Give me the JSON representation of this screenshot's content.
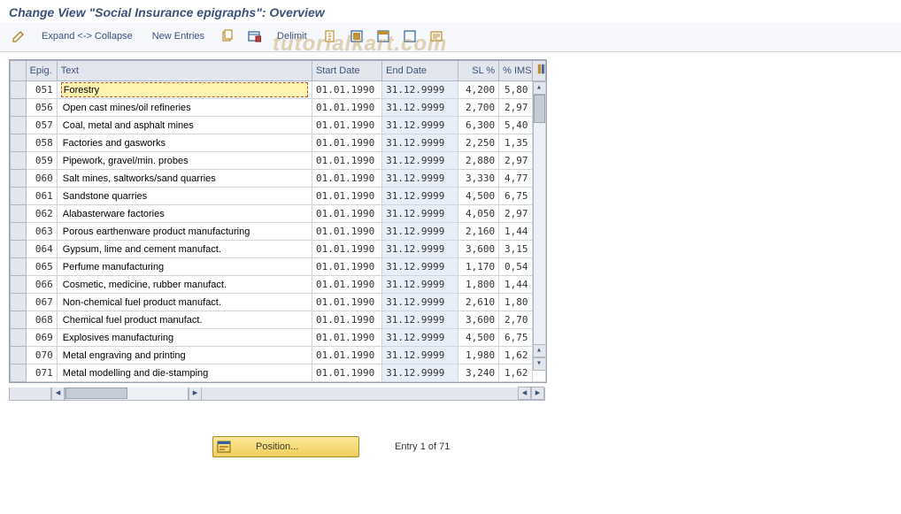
{
  "title": "Change View \"Social Insurance epigraphs\": Overview",
  "watermark": "tutorialkart.com",
  "toolbar": {
    "expand_collapse": "Expand <-> Collapse",
    "new_entries": "New Entries",
    "delimit": "Delimit"
  },
  "columns": {
    "epig": "Epig.",
    "text": "Text",
    "start": "Start Date",
    "end": "End Date",
    "sl": "SL %",
    "ims": "% IMS"
  },
  "rows": [
    {
      "epig": "051",
      "text": "Forestry",
      "start": "01.01.1990",
      "end": "31.12.9999",
      "sl": "4,200",
      "ims": "5,80"
    },
    {
      "epig": "056",
      "text": "Open cast mines/oil refineries",
      "start": "01.01.1990",
      "end": "31.12.9999",
      "sl": "2,700",
      "ims": "2,97"
    },
    {
      "epig": "057",
      "text": "Coal, metal and asphalt mines",
      "start": "01.01.1990",
      "end": "31.12.9999",
      "sl": "6,300",
      "ims": "5,40"
    },
    {
      "epig": "058",
      "text": "Factories and gasworks",
      "start": "01.01.1990",
      "end": "31.12.9999",
      "sl": "2,250",
      "ims": "1,35"
    },
    {
      "epig": "059",
      "text": "Pipework, gravel/min. probes",
      "start": "01.01.1990",
      "end": "31.12.9999",
      "sl": "2,880",
      "ims": "2,97"
    },
    {
      "epig": "060",
      "text": "Salt mines, saltworks/sand quarries",
      "start": "01.01.1990",
      "end": "31.12.9999",
      "sl": "3,330",
      "ims": "4,77"
    },
    {
      "epig": "061",
      "text": "Sandstone quarries",
      "start": "01.01.1990",
      "end": "31.12.9999",
      "sl": "4,500",
      "ims": "6,75"
    },
    {
      "epig": "062",
      "text": "Alabasterware factories",
      "start": "01.01.1990",
      "end": "31.12.9999",
      "sl": "4,050",
      "ims": "2,97"
    },
    {
      "epig": "063",
      "text": "Porous earthenware product manufacturing",
      "start": "01.01.1990",
      "end": "31.12.9999",
      "sl": "2,160",
      "ims": "1,44"
    },
    {
      "epig": "064",
      "text": "Gypsum, lime and cement manufact.",
      "start": "01.01.1990",
      "end": "31.12.9999",
      "sl": "3,600",
      "ims": "3,15"
    },
    {
      "epig": "065",
      "text": "Perfume manufacturing",
      "start": "01.01.1990",
      "end": "31.12.9999",
      "sl": "1,170",
      "ims": "0,54"
    },
    {
      "epig": "066",
      "text": "Cosmetic, medicine, rubber manufact.",
      "start": "01.01.1990",
      "end": "31.12.9999",
      "sl": "1,800",
      "ims": "1,44"
    },
    {
      "epig": "067",
      "text": "Non-chemical fuel product manufact.",
      "start": "01.01.1990",
      "end": "31.12.9999",
      "sl": "2,610",
      "ims": "1,80"
    },
    {
      "epig": "068",
      "text": "Chemical fuel product manufact.",
      "start": "01.01.1990",
      "end": "31.12.9999",
      "sl": "3,600",
      "ims": "2,70"
    },
    {
      "epig": "069",
      "text": "Explosives manufacturing",
      "start": "01.01.1990",
      "end": "31.12.9999",
      "sl": "4,500",
      "ims": "6,75"
    },
    {
      "epig": "070",
      "text": "Metal engraving and printing",
      "start": "01.01.1990",
      "end": "31.12.9999",
      "sl": "1,980",
      "ims": "1,62"
    },
    {
      "epig": "071",
      "text": "Metal modelling and die-stamping",
      "start": "01.01.1990",
      "end": "31.12.9999",
      "sl": "3,240",
      "ims": "1,62"
    }
  ],
  "footer": {
    "position_label": "Position...",
    "entry_text": "Entry 1 of 71"
  }
}
